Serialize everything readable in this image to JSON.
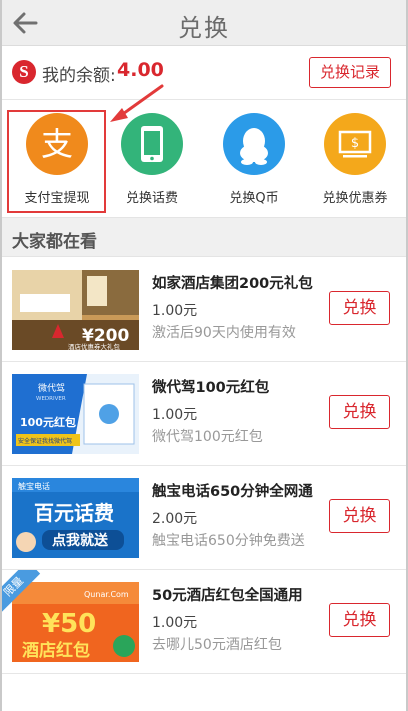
{
  "header": {
    "title": "兑换",
    "back_icon": "arrow-left-icon"
  },
  "balance": {
    "label": "我的余额:",
    "value": "4.00",
    "record_button": "兑换记录",
    "logo_letter": "S"
  },
  "options": [
    {
      "label": "支付宝提现",
      "icon": "alipay-icon",
      "color": "#f08a1c",
      "glyph": "支"
    },
    {
      "label": "兑换话费",
      "icon": "phone-icon",
      "color": "#33b47a"
    },
    {
      "label": "兑换Q币",
      "icon": "qq-icon",
      "color": "#2b9be8"
    },
    {
      "label": "兑换优惠券",
      "icon": "coupon-icon",
      "color": "#f4a81b",
      "glyph": "$"
    }
  ],
  "section": {
    "title": "大家都在看"
  },
  "items": [
    {
      "title": "如家酒店集团200元礼包",
      "price": "1.00元",
      "desc": "激活后90天内使用有效",
      "button": "兑换",
      "thumb_text": [
        "¥200",
        "酒店优惠券大礼包"
      ]
    },
    {
      "title": "微代驾100元红包",
      "price": "1.00元",
      "desc": "微代驾100元红包",
      "button": "兑换",
      "thumb_text": [
        "微代驾",
        "WEDRIVER",
        "100元红包",
        "安全保证我找微代驾"
      ]
    },
    {
      "title": "触宝电话650分钟全网通",
      "price": "2.00元",
      "desc": "触宝电话650分钟免费送",
      "button": "兑换",
      "thumb_text": [
        "触宝电话",
        "百元话费",
        "点我就送"
      ]
    },
    {
      "title": "50元酒店红包全国通用",
      "price": "1.00元",
      "desc": "去哪儿50元酒店红包",
      "button": "兑换",
      "thumb_text": [
        "Qunar.Com",
        "¥50",
        "酒店红包"
      ],
      "tag": "限量"
    }
  ],
  "colors": {
    "accent": "#d9272e",
    "highlight": "#e23a3a"
  }
}
